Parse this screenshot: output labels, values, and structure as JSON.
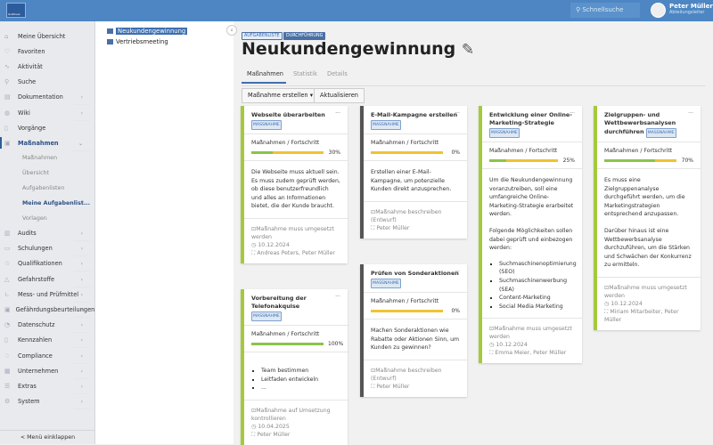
{
  "header": {
    "logo_text": "Grafiksec",
    "search_placeholder": "Schnellsuche",
    "user_name": "Peter Müller",
    "user_role": "Abteilungsleiter"
  },
  "sidebar": {
    "items": [
      {
        "label": "Meine Übersicht",
        "icon": "home-icon",
        "arrow": false
      },
      {
        "label": "Favoriten",
        "icon": "heart-icon",
        "arrow": false
      },
      {
        "label": "Aktivität",
        "icon": "activity-icon",
        "arrow": false
      },
      {
        "label": "Suche",
        "icon": "search-icon",
        "arrow": false
      },
      {
        "label": "Dokumentation",
        "icon": "book-icon",
        "arrow": true
      },
      {
        "label": "Wiki",
        "icon": "globe-icon",
        "arrow": true
      },
      {
        "label": "Vorgänge",
        "icon": "file-icon",
        "arrow": false
      },
      {
        "label": "Maßnahmen",
        "icon": "clipboard-icon",
        "arrow": "down"
      }
    ],
    "subitems": [
      "Maßnahmen",
      "Übersicht",
      "Aufgabenlisten",
      "Meine Aufgabenlist...",
      "Vorlagen"
    ],
    "items2": [
      "Audits",
      "Schulungen",
      "Qualifikationen",
      "Gefahrstoffe",
      "Mess- und Prüfmittel",
      "Gefährdungsbeurteilungen",
      "Datenschutz",
      "Kennzahlen",
      "Compliance",
      "Unternehmen",
      "Extras",
      "System"
    ],
    "collapse_label": "< Menü einklappen"
  },
  "tree": {
    "items": [
      "Neukundengewinnung",
      "Vertriebsmeeting"
    ]
  },
  "page": {
    "badges": [
      "AUFGABENLISTE",
      "DURCHFÜHRUNG"
    ],
    "title": "Neukundengewinnung",
    "tabs": [
      "Maßnahmen",
      "Statistik",
      "Details"
    ],
    "create_button": "Maßnahme erstellen ▾",
    "refresh_button": "Aktualisieren"
  },
  "cards": [
    {
      "title": "Webseite überarbeiten",
      "badge": "MASSNAHME",
      "progress_label": "Maßnahmen / Fortschritt",
      "progress": 30,
      "progress_text": "30%",
      "desc": [
        "Die Webseite muss aktuell sein. Es muss zudem geprüft werden, ob diese benutzerfreundlich und alles an Informationen bietet, die der Kunde braucht."
      ],
      "list": [],
      "status": "Maßnahme muss umgesetzt werden",
      "date": "10.12.2024",
      "people": "Andreas Peters, Peter Müller"
    },
    {
      "title": "Vorbereitung der Telefonakquise",
      "badge": "MASSNAHME",
      "progress_label": "Maßnahmen / Fortschritt",
      "progress": 100,
      "progress_text": "100%",
      "desc": [],
      "list": [
        "Team bestimmen",
        "Leitfaden entwickeln",
        "..."
      ],
      "status": "Maßnahme auf Umsetzung kontrollieren",
      "date": "10.04.2025",
      "people": "Peter Müller"
    },
    {
      "title": "E-Mail-Kampagne erstellen",
      "badge": "MASSNAHME",
      "progress_label": "Maßnahmen / Fortschritt",
      "progress": 0,
      "progress_text": "0%",
      "desc": [
        "Erstellen einer E-Mail-Kampagne, um potenzielle Kunden direkt anzusprechen."
      ],
      "list": [],
      "status": "Maßnahme beschreiben (Entwurf)",
      "date": "",
      "people": "Peter Müller"
    },
    {
      "title": "Prüfen von Sonderaktionen",
      "badge": "MASSNAHME",
      "progress_label": "Maßnahmen / Fortschritt",
      "progress": 0,
      "progress_text": "0%",
      "desc": [
        "Machen Sonderaktionen wie Rabatte oder Aktionen Sinn, um Kunden zu gewinnen?"
      ],
      "list": [],
      "status": "Maßnahme beschreiben (Entwurf)",
      "date": "",
      "people": "Peter Müller"
    },
    {
      "title": "Entwicklung einer Online-Marketing-Strategie",
      "badge": "MASSNAHME",
      "progress_label": "Maßnahmen / Fortschritt",
      "progress": 25,
      "progress_text": "25%",
      "desc": [
        "Um die Neukundengewinnung voranzutreiben, soll eine umfangreiche Online-Marketing-Strategie erarbeitet werden.",
        "Folgende Möglichkeiten sollen dabei geprüft und einbezogen werden:"
      ],
      "list": [
        "Suchmaschinenoptimierung (SEO)",
        "Suchmaschinenwerbung (SEA)",
        "Content-Marketing",
        "Social Media Marketing"
      ],
      "status": "Maßnahme muss umgesetzt werden",
      "date": "10.12.2024",
      "people": "Emma Meier, Peter Müller"
    },
    {
      "title": "Zielgruppen- und Wettbewerbsanalysen durchführen",
      "badge": "MASSNAHME",
      "progress_label": "Maßnahmen / Fortschritt",
      "progress": 70,
      "progress_text": "70%",
      "desc": [
        "Es muss eine Zielgruppenanalyse durchgeführt werden, um die Marketingstrategien entsprechend anzupassen.",
        "Darüber hinaus ist eine Wettbewerbsanalyse durchzuführen, um die Stärken und Schwächen der Konkurrenz zu ermitteln."
      ],
      "list": [],
      "status": "Maßnahme muss umgesetzt werden",
      "date": "10.12.2024",
      "people": "Miriam Mitarbeiter, Peter Müller"
    }
  ]
}
